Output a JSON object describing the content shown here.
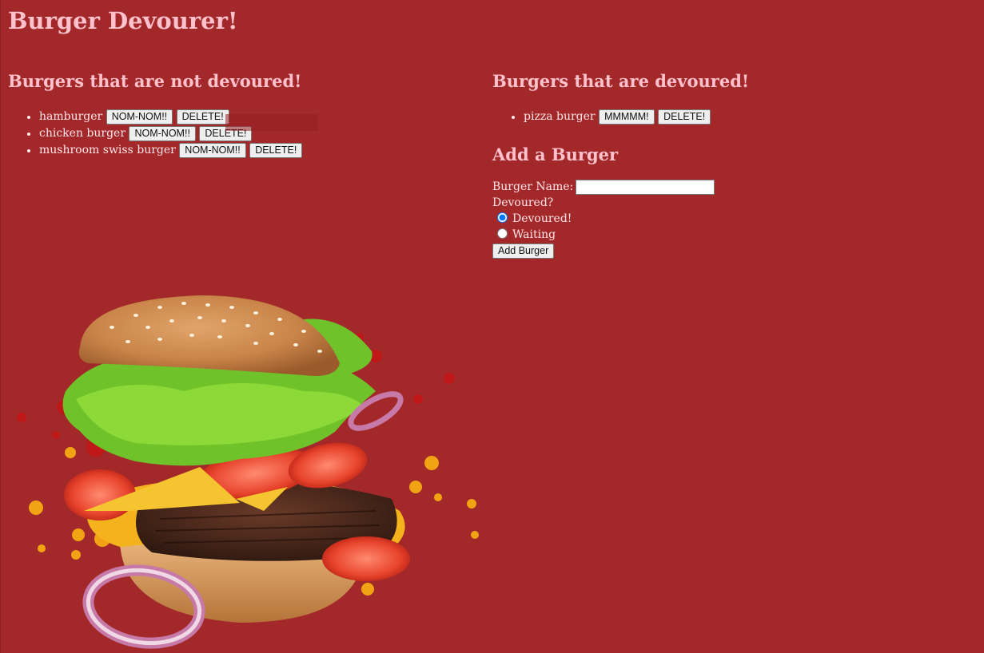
{
  "page": {
    "title": "Burger Devourer!"
  },
  "not_devoured": {
    "heading": "Burgers that are not devoured!",
    "items": [
      {
        "name": "hamburger",
        "action_label": "NOM-NOM!!",
        "delete_label": "DELETE!"
      },
      {
        "name": "chicken burger",
        "action_label": "NOM-NOM!!",
        "delete_label": "DELETE!"
      },
      {
        "name": "mushroom swiss burger",
        "action_label": "NOM-NOM!!",
        "delete_label": "DELETE!"
      }
    ]
  },
  "devoured": {
    "heading": "Burgers that are devoured!",
    "items": [
      {
        "name": "pizza burger",
        "action_label": "MMMMM!",
        "delete_label": "DELETE!"
      }
    ]
  },
  "add_form": {
    "heading": "Add a Burger",
    "name_label": "Burger Name:",
    "name_value": "",
    "devoured_label": "Devoured?",
    "options": [
      {
        "label": "Devoured!",
        "checked": true
      },
      {
        "label": "Waiting",
        "checked": false
      }
    ],
    "submit_label": "Add Burger"
  },
  "colors": {
    "background": "#a3282a",
    "heading": "#ffc2cc",
    "radio_accent": "#1a73e8"
  },
  "icons": {
    "hero_image": "burger-illustration"
  }
}
